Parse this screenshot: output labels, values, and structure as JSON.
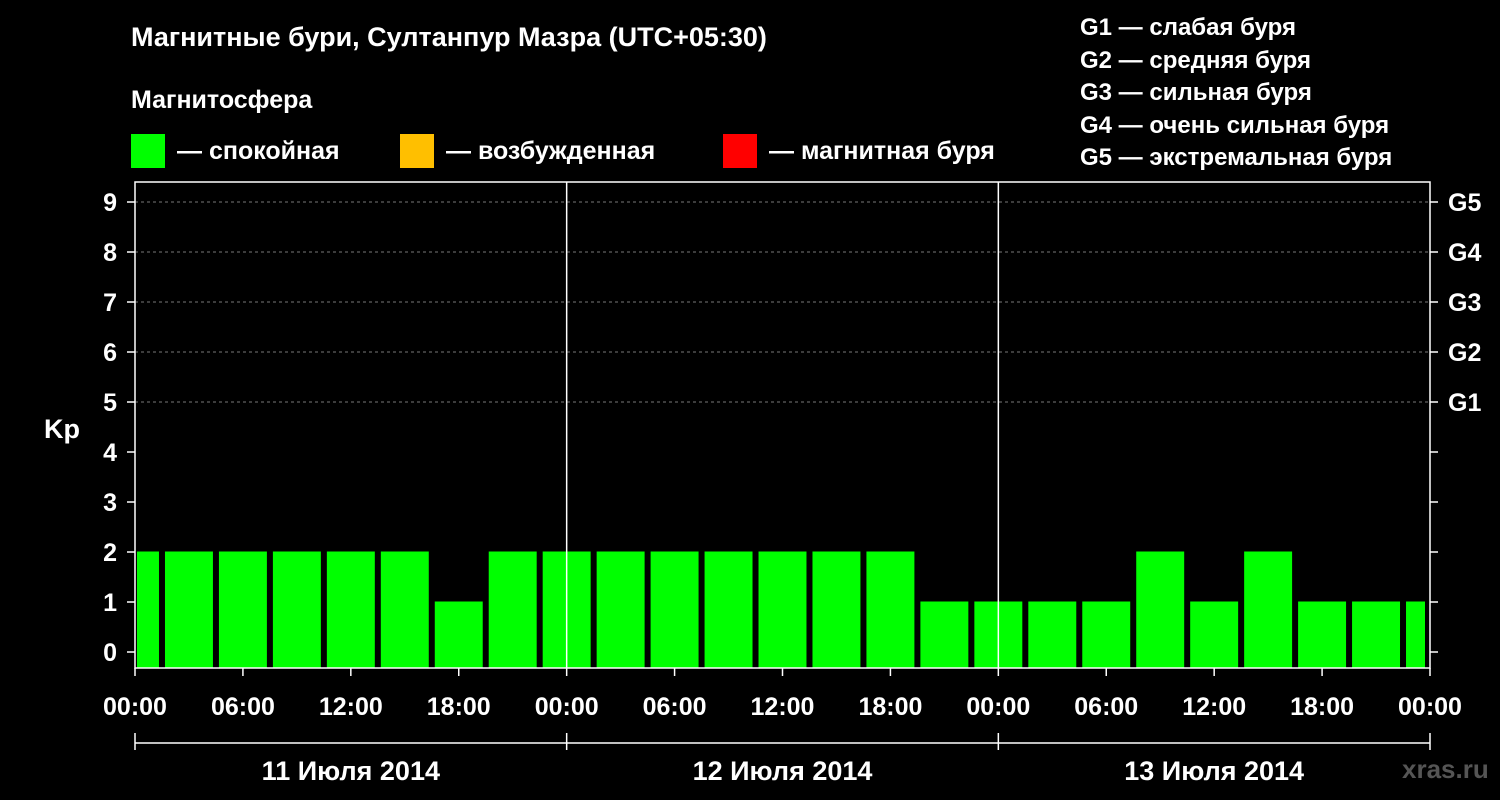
{
  "chart_data": {
    "type": "bar",
    "title": "Магнитные бури, Султанпур Мазра (UTC+05:30)",
    "subtitle": "Магнитосфера",
    "ylabel": "Kp",
    "ylim": [
      0,
      9
    ],
    "yticks": [
      "0",
      "1",
      "2",
      "3",
      "4",
      "5",
      "6",
      "7",
      "8",
      "9"
    ],
    "right_axis_labels": [
      {
        "kp": 5,
        "label": "G1"
      },
      {
        "kp": 6,
        "label": "G2"
      },
      {
        "kp": 7,
        "label": "G3"
      },
      {
        "kp": 8,
        "label": "G4"
      },
      {
        "kp": 9,
        "label": "G5"
      }
    ],
    "legend": [
      {
        "label": "— спокойная",
        "color": "#00ff00"
      },
      {
        "label": "— возбужденная",
        "color": "#ffbf00"
      },
      {
        "label": "— магнитная буря",
        "color": "#ff0000"
      }
    ],
    "storm_levels": [
      "G1 — слабая буря",
      "G2 — средняя буря",
      "G3 — сильная буря",
      "G4 — очень сильная буря",
      "G5 — экстремальная буря"
    ],
    "x_tick_labels": [
      "00:00",
      "06:00",
      "12:00",
      "18:00",
      "00:00",
      "06:00",
      "12:00",
      "18:00",
      "00:00",
      "06:00",
      "12:00",
      "18:00",
      "00:00"
    ],
    "days": [
      "11 Июля 2014",
      "12 Июля 2014",
      "13 Июля 2014"
    ],
    "interval_hours": 3,
    "start_offset_hours": -1.5,
    "values": [
      2,
      2,
      2,
      2,
      2,
      2,
      1,
      2,
      2,
      2,
      2,
      2,
      2,
      2,
      2,
      1,
      1,
      1,
      1,
      2,
      1,
      2,
      1,
      1,
      1
    ],
    "bar_color": "#00ff00",
    "grid": true
  },
  "watermark": "xras.ru"
}
